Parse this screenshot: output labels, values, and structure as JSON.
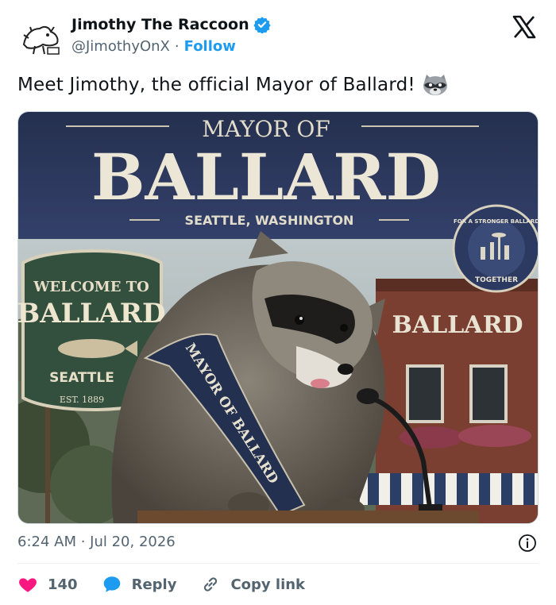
{
  "author": {
    "display_name": "Jimothy The Raccoon",
    "handle": "@JimothyOnX",
    "separator": "·",
    "follow_label": "Follow"
  },
  "tweet": {
    "text": "Meet Jimothy, the official Mayor of Ballard!",
    "emoji": "raccoon-emoji"
  },
  "image": {
    "banner_top": "MAYOR OF",
    "banner_main": "BALLARD",
    "banner_sub": "SEATTLE, WASHINGTON",
    "badge_top": "FOR A STRONGER BALLARD",
    "badge_bottom": "TOGETHER",
    "sign_welcome": "WELCOME TO",
    "sign_main": "BALLARD",
    "sign_city": "SEATTLE",
    "sign_est": "EST. 1889",
    "building_sign": "BALLARD",
    "sash_text": "MAYOR OF BALLARD"
  },
  "meta": {
    "timestamp": "6:24 AM · Jul 20, 2026"
  },
  "actions": {
    "likes": "140",
    "reply_label": "Reply",
    "copy_label": "Copy link"
  },
  "colors": {
    "like": "#f91880",
    "reply": "#1d9bf0",
    "follow": "#1d9bf0",
    "banner": "#2a3658"
  }
}
